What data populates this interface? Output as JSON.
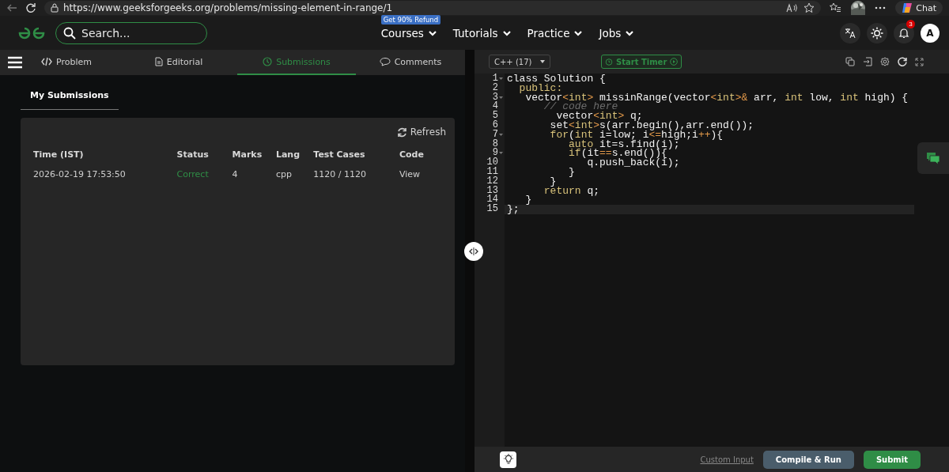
{
  "browser": {
    "url": "https://www.geeksforgeeks.org/problems/missing-element-in-range/1",
    "chat_button": "Chat"
  },
  "header": {
    "search": {
      "placeholder": "Search..."
    },
    "promo_badge": "Get 90% Refund",
    "nav": [
      {
        "label": "Courses"
      },
      {
        "label": "Tutorials"
      },
      {
        "label": "Practice"
      },
      {
        "label": "Jobs"
      }
    ],
    "notification_count": "3",
    "avatar": "A"
  },
  "left_panel": {
    "tabs": [
      {
        "label": "Problem",
        "selected": false
      },
      {
        "label": "Editorial",
        "selected": false
      },
      {
        "label": "Submissions",
        "selected": true
      },
      {
        "label": "Comments",
        "selected": false
      }
    ],
    "subtabs": [
      {
        "label": "My Submissions",
        "selected": true
      }
    ],
    "refresh": "Refresh",
    "table": {
      "columns": [
        "Time (IST)",
        "Status",
        "Marks",
        "Lang",
        "Test Cases",
        "Code"
      ],
      "rows": [
        {
          "time": "2026-02-19 17:53:50",
          "status": {
            "text": "Correct",
            "kind": "correct"
          },
          "marks": "4",
          "lang": "cpp",
          "test_cases": "1120 / 1120",
          "code": "View"
        }
      ]
    }
  },
  "editor": {
    "language": "C++ (17)",
    "timer": "Start Timer",
    "lines": [
      {
        "number": "1",
        "foldable": true,
        "current": false,
        "tokens": [
          {
            "kind": "plain",
            "text": "class Solution {"
          }
        ]
      },
      {
        "number": "2",
        "foldable": false,
        "current": false,
        "tokens": [
          {
            "kind": "keyword",
            "text": "  public:"
          }
        ]
      },
      {
        "number": "3",
        "foldable": true,
        "current": false,
        "tokens": [
          {
            "kind": "plain",
            "text": "   vector"
          },
          {
            "kind": "op",
            "text": "<"
          },
          {
            "kind": "keyword",
            "text": "int"
          },
          {
            "kind": "op",
            "text": ">"
          },
          {
            "kind": "plain",
            "text": " missinRange(vector"
          },
          {
            "kind": "op",
            "text": "<"
          },
          {
            "kind": "keyword",
            "text": "int"
          },
          {
            "kind": "op",
            "text": ">&"
          },
          {
            "kind": "plain",
            "text": " arr, "
          },
          {
            "kind": "keyword",
            "text": "int"
          },
          {
            "kind": "plain",
            "text": " low, "
          },
          {
            "kind": "keyword",
            "text": "int"
          },
          {
            "kind": "plain",
            "text": " high) {"
          }
        ]
      },
      {
        "number": "4",
        "foldable": false,
        "current": false,
        "tokens": [
          {
            "kind": "comment",
            "text": "      // code here"
          }
        ]
      },
      {
        "number": "5",
        "foldable": false,
        "current": false,
        "tokens": [
          {
            "kind": "plain",
            "text": "        vector"
          },
          {
            "kind": "op",
            "text": "<"
          },
          {
            "kind": "keyword",
            "text": "int"
          },
          {
            "kind": "op",
            "text": ">"
          },
          {
            "kind": "plain",
            "text": " q;"
          }
        ]
      },
      {
        "number": "6",
        "foldable": false,
        "current": false,
        "tokens": [
          {
            "kind": "plain",
            "text": "       set"
          },
          {
            "kind": "op",
            "text": "<"
          },
          {
            "kind": "keyword",
            "text": "int"
          },
          {
            "kind": "op",
            "text": ">"
          },
          {
            "kind": "plain",
            "text": "s(arr.begin(),arr.end());"
          }
        ]
      },
      {
        "number": "7",
        "foldable": true,
        "current": false,
        "tokens": [
          {
            "kind": "keyword",
            "text": "       for"
          },
          {
            "kind": "plain",
            "text": "("
          },
          {
            "kind": "keyword",
            "text": "int"
          },
          {
            "kind": "plain",
            "text": " i=low; i"
          },
          {
            "kind": "op",
            "text": "<="
          },
          {
            "kind": "plain",
            "text": "high;i"
          },
          {
            "kind": "op",
            "text": "++"
          },
          {
            "kind": "plain",
            "text": "){"
          }
        ]
      },
      {
        "number": "8",
        "foldable": false,
        "current": false,
        "tokens": [
          {
            "kind": "keyword",
            "text": "          auto"
          },
          {
            "kind": "plain",
            "text": " it=s.find(i);"
          }
        ]
      },
      {
        "number": "9",
        "foldable": true,
        "current": false,
        "tokens": [
          {
            "kind": "keyword",
            "text": "          if"
          },
          {
            "kind": "plain",
            "text": "(it"
          },
          {
            "kind": "op",
            "text": "=="
          },
          {
            "kind": "plain",
            "text": "s.end()){"
          }
        ]
      },
      {
        "number": "10",
        "foldable": false,
        "current": false,
        "tokens": [
          {
            "kind": "plain",
            "text": "             q.push_back(i);"
          }
        ]
      },
      {
        "number": "11",
        "foldable": false,
        "current": false,
        "tokens": [
          {
            "kind": "plain",
            "text": "          }"
          }
        ]
      },
      {
        "number": "12",
        "foldable": false,
        "current": false,
        "tokens": [
          {
            "kind": "plain",
            "text": "       }"
          }
        ]
      },
      {
        "number": "13",
        "foldable": false,
        "current": false,
        "tokens": [
          {
            "kind": "keyword",
            "text": "      return"
          },
          {
            "kind": "plain",
            "text": " q;"
          }
        ]
      },
      {
        "number": "14",
        "foldable": false,
        "current": false,
        "tokens": [
          {
            "kind": "plain",
            "text": "   }"
          }
        ]
      },
      {
        "number": "15",
        "foldable": false,
        "current": true,
        "tokens": [
          {
            "kind": "plain",
            "text": "};"
          }
        ]
      }
    ]
  },
  "footer": {
    "custom_input": "Custom Input",
    "buttons": [
      {
        "label": "Compile & Run",
        "kind": "secondary"
      },
      {
        "label": "Submit",
        "kind": "primary"
      }
    ]
  }
}
